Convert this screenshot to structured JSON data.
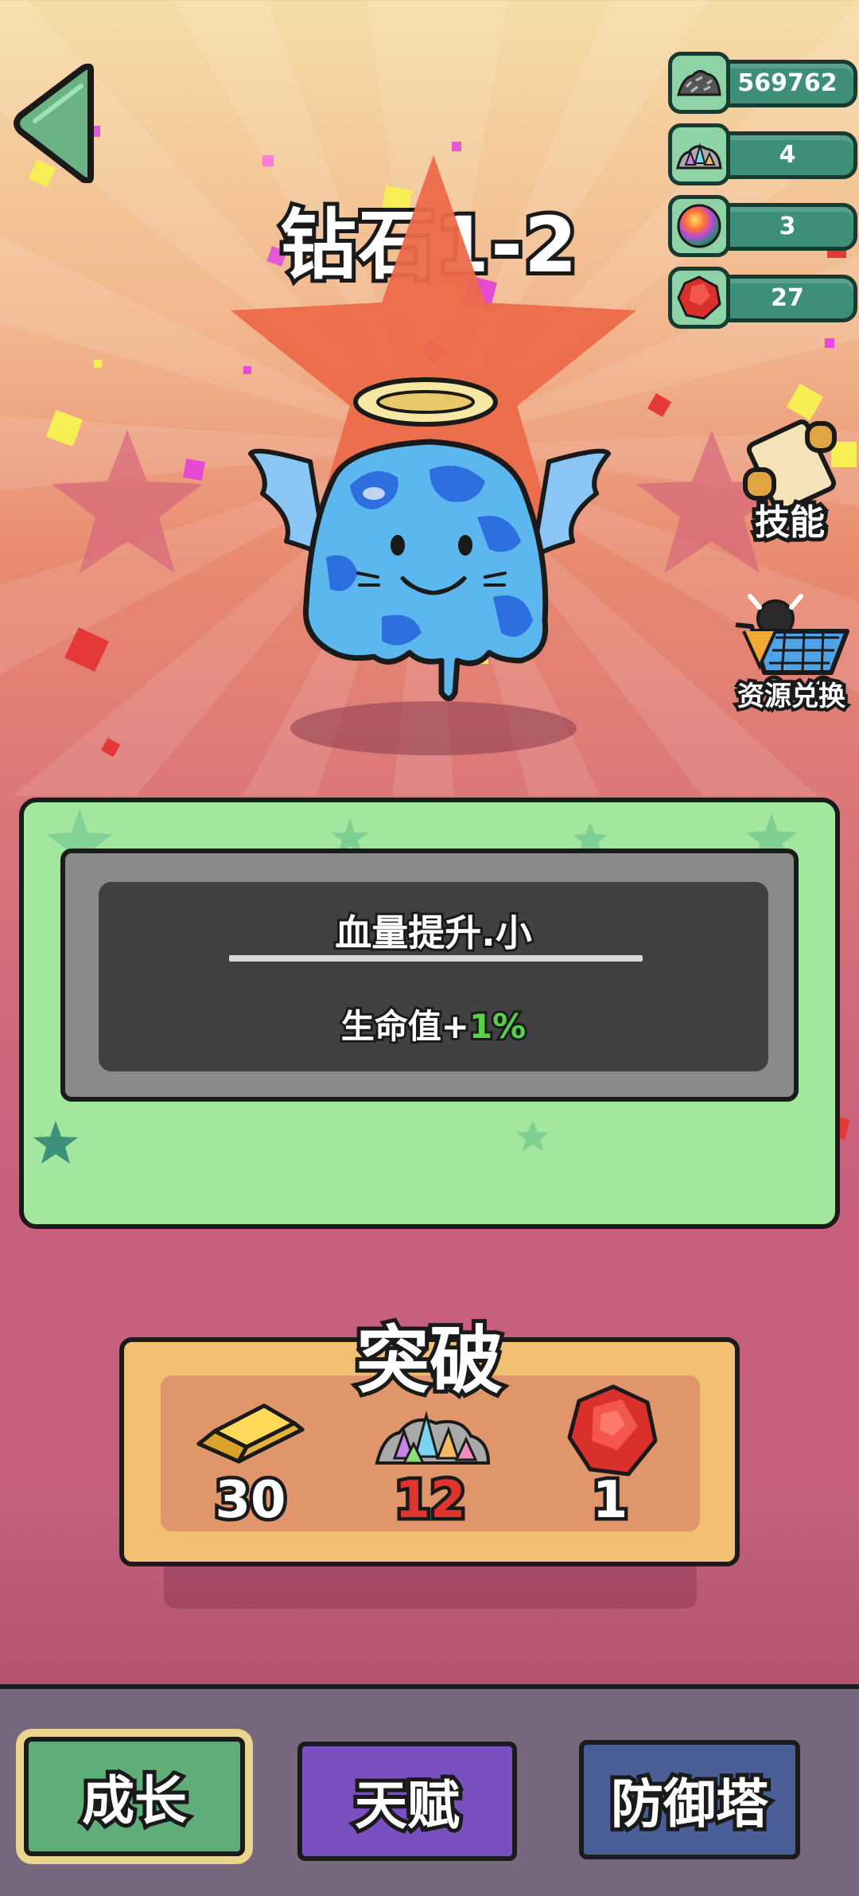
{
  "header": {
    "level_title": "钻石1-2",
    "back_icon": "back-arrow-icon"
  },
  "resources": [
    {
      "icon": "stone-pile-icon",
      "value": "569762"
    },
    {
      "icon": "crystal-pile-icon",
      "value": "4"
    },
    {
      "icon": "rainbow-orb-icon",
      "value": "3"
    },
    {
      "icon": "red-gem-icon",
      "value": "27"
    }
  ],
  "side_buttons": {
    "skill_label": "技能",
    "exchange_label": "资源兑换"
  },
  "character": {
    "icon": "angel-slime-icon"
  },
  "info_panel": {
    "skill_name": "血量提升.小",
    "desc_prefix": "生命值+",
    "desc_value": "1%"
  },
  "breakthrough": {
    "title": "突破",
    "costs": [
      {
        "icon": "gold-bar-icon",
        "amount": "30",
        "sufficient": true
      },
      {
        "icon": "crystal-pile-icon",
        "amount": "12",
        "sufficient": false
      },
      {
        "icon": "red-gem-icon",
        "amount": "1",
        "sufficient": true
      }
    ]
  },
  "nav": {
    "tabs": [
      {
        "label": "成长",
        "active": true,
        "color": "#5fae7a"
      },
      {
        "label": "天赋",
        "active": false,
        "color": "#7a4fc0"
      },
      {
        "label": "防御塔",
        "active": false,
        "color": "#4a5f98"
      }
    ]
  }
}
